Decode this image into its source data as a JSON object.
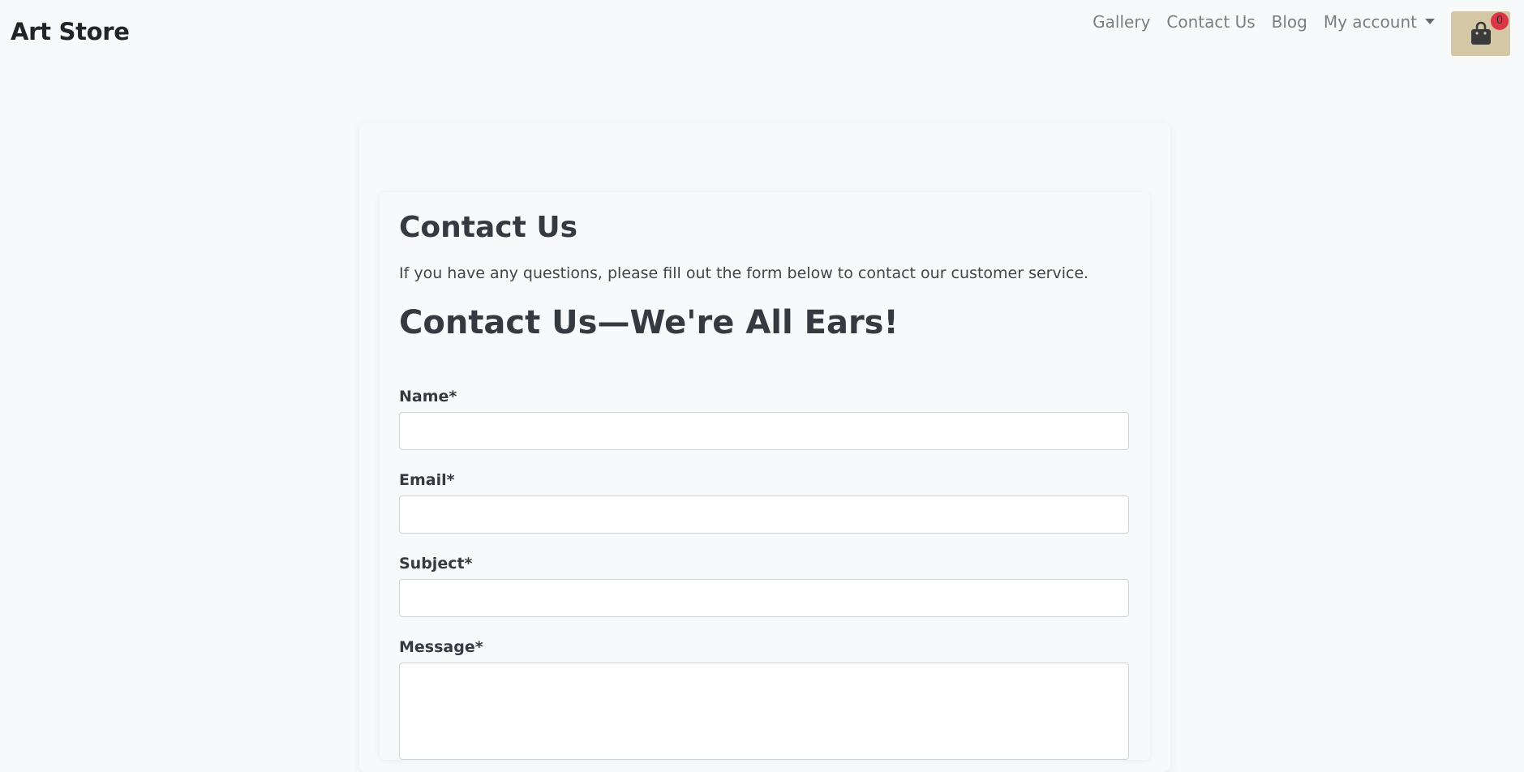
{
  "brand": "Art Store",
  "nav": {
    "gallery": "Gallery",
    "contact": "Contact Us",
    "blog": "Blog",
    "account": "My account"
  },
  "cart": {
    "count": "0",
    "icon": "shopping-bag-icon"
  },
  "content": {
    "title": "Contact Us",
    "intro": "If you have any questions, please fill out the form below to contact our customer service.",
    "heading": "Contact Us—We're All Ears!"
  },
  "form": {
    "name_label": "Name*",
    "name_value": "",
    "email_label": "Email*",
    "email_value": "",
    "subject_label": "Subject*",
    "subject_value": "",
    "message_label": "Message*",
    "message_value": ""
  },
  "colors": {
    "background": "#f8f9fa",
    "cart_button": "#d3c7a6",
    "badge": "#dc3545",
    "heading_text": "#343a40"
  }
}
